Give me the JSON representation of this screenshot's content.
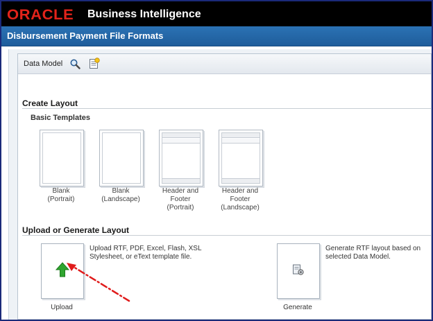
{
  "header": {
    "brand": "ORACLE",
    "app_title": "Business Intelligence"
  },
  "page": {
    "title": "Disbursement Payment File Formats"
  },
  "toolbar": {
    "data_model_label": "Data Model",
    "icons": [
      "search-icon",
      "properties-icon"
    ]
  },
  "create_layout": {
    "title": "Create Layout",
    "basic_templates_title": "Basic Templates",
    "templates": [
      {
        "line1": "Blank",
        "line2": "(Portrait)",
        "line3": ""
      },
      {
        "line1": "Blank",
        "line2": "(Landscape)",
        "line3": ""
      },
      {
        "line1": "Header and",
        "line2": "Footer",
        "line3": "(Portrait)"
      },
      {
        "line1": "Header and",
        "line2": "Footer",
        "line3": "(Landscape)"
      }
    ]
  },
  "upload_generate": {
    "title": "Upload or Generate Layout",
    "upload": {
      "desc_line1": "Upload RTF, PDF, Excel, Flash, XSL",
      "desc_line2": "Stylesheet, or eText template file.",
      "label": "Upload",
      "icon": "upload-arrow-icon"
    },
    "generate": {
      "desc_line1": "Generate RTF layout based on",
      "desc_line2": "selected Data Model.",
      "label": "Generate",
      "icon": "generate-gear-icon"
    }
  },
  "colors": {
    "oracle_red": "#e2231a",
    "title_bar_blue": "#2b72b4",
    "frame_border": "#1b2a7a",
    "upload_arrow_green": "#2fa52f",
    "annotation_red": "#e01b1b"
  }
}
